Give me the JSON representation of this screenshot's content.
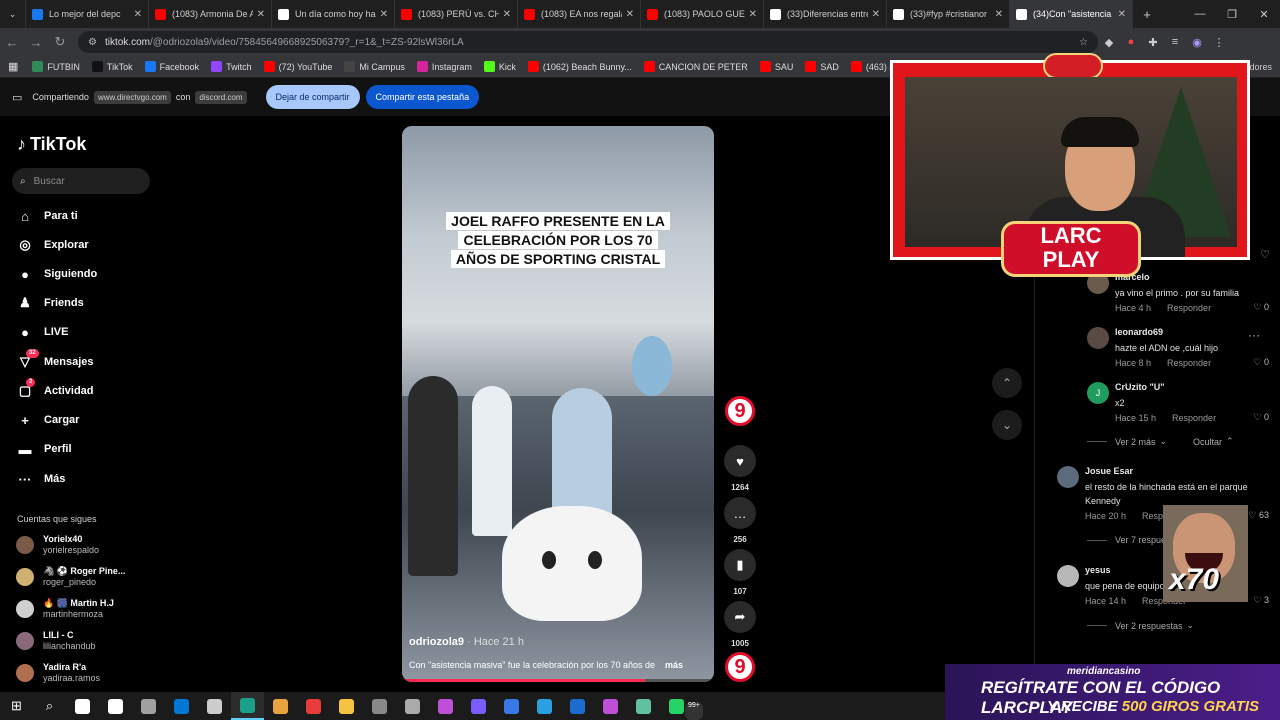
{
  "tabs": [
    {
      "title": "Lo mejor del depc",
      "color": "#1877f2"
    },
    {
      "title": "(1083) Armonia De A",
      "color": "#ff0000"
    },
    {
      "title": "Un día como hoy hac",
      "color": "#ffffff"
    },
    {
      "title": "(1083) PERÚ vs. CHILI",
      "color": "#ff0000"
    },
    {
      "title": "(1083) EA nos regalar",
      "color": "#ff0000"
    },
    {
      "title": "(1083) PAOLO GUERR",
      "color": "#ff0000"
    },
    {
      "title": "(33)Diferencias entre",
      "color": "#ffffff"
    },
    {
      "title": "(33)#fyp #cristianor",
      "color": "#ffffff"
    },
    {
      "title": "(34)Con \"asistencia m",
      "color": "#ffffff",
      "active": true
    }
  ],
  "address": {
    "host": "tiktok.com",
    "path": "/@odriozola9/video/7584564966892506379?_r=1&_t=ZS-92lsWl36rLA"
  },
  "bookmarks": [
    {
      "label": "FUTBIN",
      "color": "#2e8b57"
    },
    {
      "label": "TikTok",
      "color": "#111111"
    },
    {
      "label": "Facebook",
      "color": "#1877f2"
    },
    {
      "label": "Twitch",
      "color": "#9146ff"
    },
    {
      "label": "(72) YouTube",
      "color": "#ff0000"
    },
    {
      "label": "Mi Campus",
      "color": "#444444"
    },
    {
      "label": "Instagram",
      "color": "#d6249f"
    },
    {
      "label": "Kick",
      "color": "#53fc18"
    },
    {
      "label": "(1062) Beach Bunny...",
      "color": "#ff0000"
    },
    {
      "label": "CANCION DE PETER",
      "color": "#ff0000"
    },
    {
      "label": "SAU",
      "color": "#ff0000"
    },
    {
      "label": "SAD",
      "color": "#ff0000"
    },
    {
      "label": "(463) James Arthur -...",
      "color": "#ff0000"
    },
    {
      "label": "DE",
      "color": "#ff0000"
    }
  ],
  "bookmarks_more": "adores",
  "share": {
    "label": "Compartiendo",
    "site": "www.directvgo.com",
    "with": "con",
    "target": "discord.com",
    "stop": "Dejar de compartir",
    "share_tab": "Compartir esta pestaña"
  },
  "sidebar": {
    "logo": "TikTok",
    "search_placeholder": "Buscar",
    "nav": [
      {
        "label": "Para ti",
        "icon": "⌂"
      },
      {
        "label": "Explorar",
        "icon": "◎"
      },
      {
        "label": "Siguiendo",
        "icon": "●"
      },
      {
        "label": "Friends",
        "icon": "♟"
      },
      {
        "label": "LIVE",
        "icon": "●"
      },
      {
        "label": "Mensajes",
        "icon": "▽",
        "badge": "32"
      },
      {
        "label": "Actividad",
        "icon": "▢",
        "badge": "2"
      },
      {
        "label": "Cargar",
        "icon": "+"
      },
      {
        "label": "Perfil",
        "icon": "▬"
      },
      {
        "label": "Más",
        "icon": "···"
      }
    ],
    "following_header": "Cuentas que sigues",
    "following": [
      {
        "name": "Yorielx40",
        "handle": "yorielrespaldo",
        "color": "#7a5a48"
      },
      {
        "name": "🦓 ⚽ Roger Pine...",
        "handle": "roger_pinedo",
        "color": "#d0b070"
      },
      {
        "name": "🔥 🎆 Martin H.J",
        "handle": "martinhermoza",
        "color": "#cfcfcf"
      },
      {
        "name": "LILI - C",
        "handle": "lilianchandub",
        "color": "#8a6a7a"
      },
      {
        "name": "Yadira R'a",
        "handle": "yadiraa.ramos",
        "color": "#b07050"
      }
    ]
  },
  "video": {
    "caption": "JOEL RAFFO PRESENTE EN LA CELEBRACIÓN POR LOS 70 AÑOS DE SPORTING CRISTAL",
    "author": "odriozola9",
    "time": "Hace 21 h",
    "description": "Con \"asistencia masiva\" fue la celebración por los 70 años de",
    "more": "más",
    "progress": 0.78
  },
  "actions": {
    "likes": "1264",
    "comments": "256",
    "saves": "107",
    "shares": "1005",
    "channel_logo": "9"
  },
  "comments": [
    {
      "user": "marcelo",
      "text": "ya vino el primo . por su familia",
      "time": "Hace 4 h",
      "reply": "Responder",
      "likes": "0",
      "color": "#6b5b4b"
    },
    {
      "user": "leonardo69",
      "text": "hazte el ADN oe ,cuál hijo",
      "time": "Hace 8 h",
      "reply": "Responder",
      "likes": "0",
      "color": "#5a4a44"
    },
    {
      "user": "CrUzito \"U\"",
      "text": "x2",
      "time": "Hace 15 h",
      "reply": "Responder",
      "likes": "0",
      "color": "#1f9c5e",
      "initial": "J"
    },
    {
      "user": "Josue Esar",
      "text": "el resto de la hinchada está en el parque Kennedy",
      "time": "Hace 20 h",
      "reply": "Responder",
      "likes": "63",
      "color": "#5b6b7b"
    },
    {
      "user": "yesus",
      "text": "que pena de equipo",
      "time": "Hace 14 h",
      "reply": "Responder",
      "likes": "3",
      "color": "#b8b8b8"
    }
  ],
  "comment_links": {
    "more_2": "Ver 2 más",
    "hide": "Ocultar",
    "replies_7": "Ver 7 respuestas",
    "replies_2": "Ver 2 respuestas"
  },
  "overlay": {
    "brand_top": "LARC",
    "brand_bottom": "PLAY",
    "meme_text": "x70"
  },
  "casino": {
    "site": "meridiancasino",
    "line1": "REGÍTRATE CON EL CÓDIGO LARCPLAY",
    "line2_prefix": "Y RECIBE",
    "line2_bold": "500 GIROS GRATIS"
  },
  "taskbar": {
    "apps": [
      "#ffffff",
      "#ffffff",
      "#a0a0a0",
      "#0078d4",
      "#cccccc",
      "#1aa08a",
      "#e8a33c",
      "#e83c3c",
      "#f5c242",
      "#888888",
      "#aaaaaa",
      "#c04fd8",
      "#7a5cff",
      "#3b78e7",
      "#2aa0e0",
      "#1d6ad0",
      "#c04fd8",
      "#60c0a0",
      "#25d366"
    ],
    "badge": "99+"
  }
}
